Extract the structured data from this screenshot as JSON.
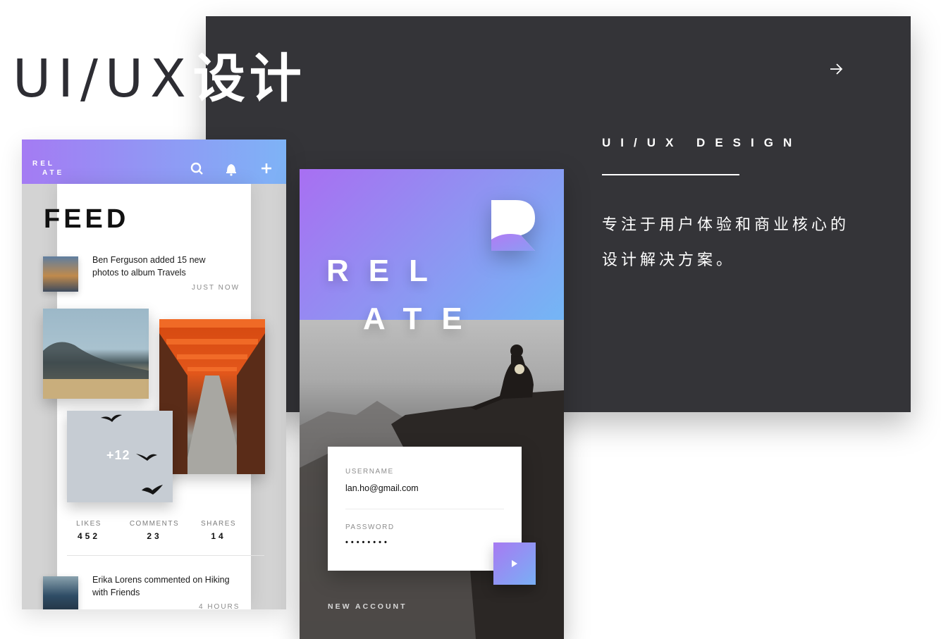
{
  "headline": {
    "text_en": "UI/UX",
    "text_cn": "设计"
  },
  "panel": {
    "arrow_icon": "arrow-right-icon",
    "subtitle": "UI/UX DESIGN",
    "description_line1": "专注于用户体验和商业核心的",
    "description_line2": "设计解决方案。"
  },
  "feed_app": {
    "logo_line1": "REL",
    "logo_line2": "ATE",
    "header_icons": [
      "search-icon",
      "bell-icon",
      "plus-icon"
    ],
    "colors": {
      "gradient_start": "#a47bf3",
      "gradient_end": "#7eb3f6"
    },
    "title": "FEED",
    "posts": [
      {
        "text": "Ben Ferguson added 15 new photos to album Travels",
        "time": "JUST NOW"
      },
      {
        "text": "Erika Lorens commented on Hiking with Friends",
        "time": "4 HOURS"
      }
    ],
    "more_photos": "+12",
    "stats": [
      {
        "label": "LIKES",
        "value": "452"
      },
      {
        "label": "COMMENTS",
        "value": "23"
      },
      {
        "label": "SHARES",
        "value": "14"
      }
    ]
  },
  "login_app": {
    "brand_line1": "REL",
    "brand_line2": "ATE",
    "colors": {
      "gradient_start": "#a86ff2",
      "gradient_end": "#74b6f5"
    },
    "username_label": "USERNAME",
    "username_value": "lan.ho@gmail.com",
    "password_label": "PASSWORD",
    "password_value": "••••••••",
    "submit_icon": "play-icon",
    "new_account": "NEW ACCOUNT"
  }
}
